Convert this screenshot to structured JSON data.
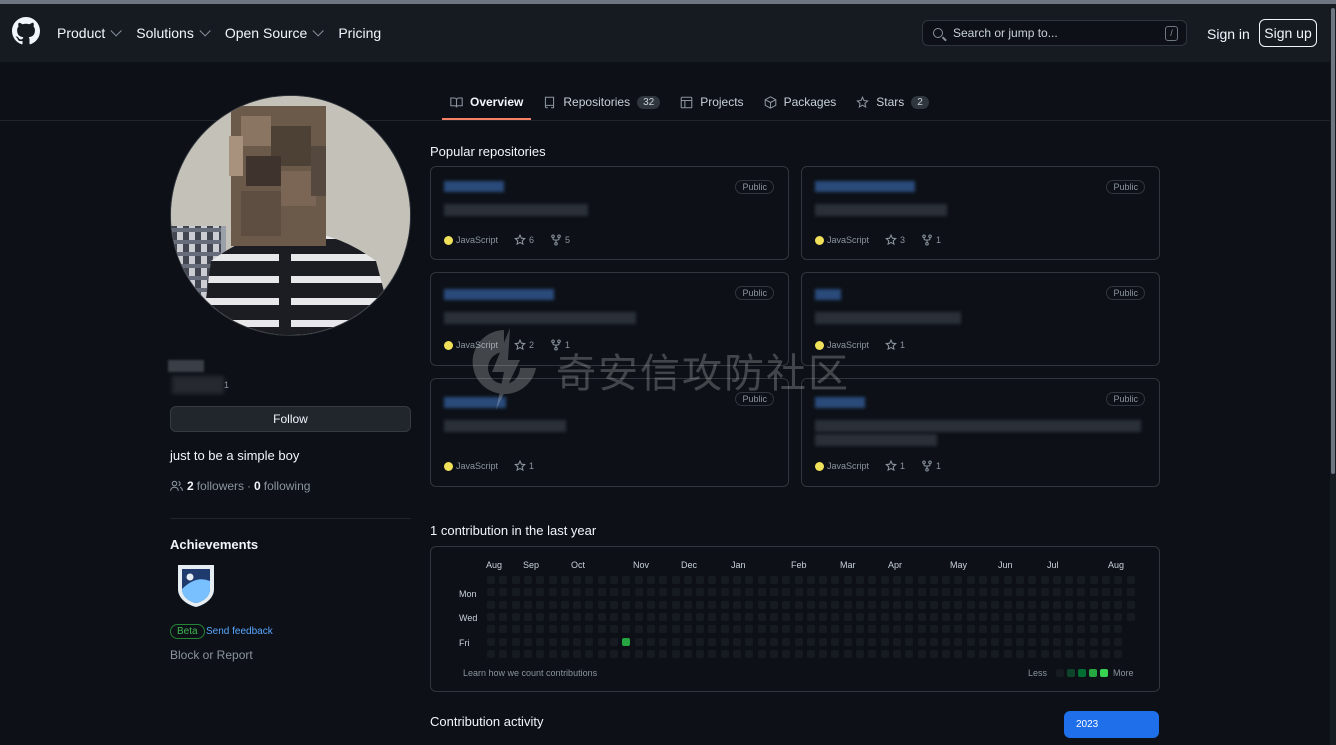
{
  "header": {
    "nav": [
      {
        "label": "Product",
        "dropdown": true
      },
      {
        "label": "Solutions",
        "dropdown": true
      },
      {
        "label": "Open Source",
        "dropdown": true
      },
      {
        "label": "Pricing",
        "dropdown": false
      }
    ],
    "search_placeholder": "Search or jump to...",
    "search_shortcut": "/",
    "sign_in": "Sign in",
    "sign_up": "Sign up"
  },
  "tabs": [
    {
      "label": "Overview",
      "icon": "book-icon",
      "active": true
    },
    {
      "label": "Repositories",
      "icon": "repo-icon",
      "count": "32"
    },
    {
      "label": "Projects",
      "icon": "table-icon"
    },
    {
      "label": "Packages",
      "icon": "package-icon"
    },
    {
      "label": "Stars",
      "icon": "star-icon",
      "count": "2"
    }
  ],
  "profile": {
    "follow_label": "Follow",
    "bio": "just to be a simple boy",
    "followers_count": "2",
    "followers_label": "followers",
    "following_count": "0",
    "following_label": "following",
    "separator": "·",
    "achievements_title": "Achievements",
    "beta_label": "Beta",
    "feedback_label": "Send feedback",
    "block_label": "Block or Report",
    "name_fragment": "1"
  },
  "popular": {
    "title": "Popular repositories",
    "repos": [
      {
        "visibility": "Public",
        "language": "JavaScript",
        "stars": "6",
        "forks": "5"
      },
      {
        "visibility": "Public",
        "language": "JavaScript",
        "stars": "3",
        "forks": "1"
      },
      {
        "visibility": "Public",
        "language": "JavaScript",
        "stars": "2",
        "forks": "1"
      },
      {
        "visibility": "Public",
        "language": "JavaScript",
        "stars": "1",
        "forks": ""
      },
      {
        "visibility": "Public",
        "language": "JavaScript",
        "stars": "1",
        "forks": ""
      },
      {
        "visibility": "Public",
        "language": "JavaScript",
        "stars": "1",
        "forks": "1"
      }
    ]
  },
  "contributions": {
    "title": "1 contribution in the last year",
    "months": [
      "Aug",
      "Sep",
      "Oct",
      "Nov",
      "Dec",
      "Jan",
      "Feb",
      "Mar",
      "Apr",
      "May",
      "Jun",
      "Jul",
      "Aug"
    ],
    "days": [
      "Mon",
      "Wed",
      "Fri"
    ],
    "learn_label": "Learn how we count contributions",
    "less_label": "Less",
    "more_label": "More",
    "active_day": {
      "week": 11,
      "weekday": 5,
      "level": 3
    },
    "colors": {
      "empty": "#161b22",
      "level1": "#0e4429",
      "level2": "#006d32",
      "level3": "#26a641",
      "level4": "#39d353"
    }
  },
  "activity": {
    "title": "Contribution activity",
    "year": "2023"
  },
  "watermark": {
    "text": "奇安信攻防社区"
  },
  "colors": {
    "accent": "#f78166",
    "link": "#58a6ff",
    "button": "#1f6feb",
    "javascript": "#f1e05a"
  }
}
